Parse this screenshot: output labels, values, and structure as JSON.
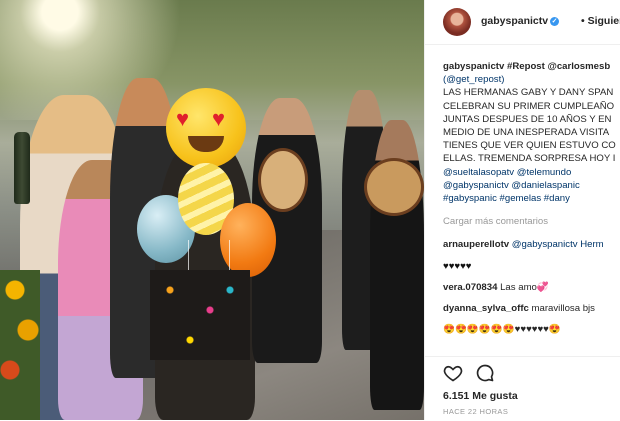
{
  "post": {
    "username": "gabyspanictv",
    "follow_label": "• Siguiendo"
  },
  "caption": {
    "lines": [
      "gabyspanictv #Repost @carlosmesb",
      "(@get_repost)",
      "LAS HERMANAS GABY Y DANY SPAN",
      "CELEBRAN SU PRIMER CUMPLEAÑO",
      "JUNTAS DESPUES DE 10 AÑOS Y EN",
      "MEDIO DE UNA INESPERADA VISITA",
      "TIENES QUE VER QUIEN ESTUVO CO",
      "ELLAS. TREMENDA SORPRESA HOY I",
      "@sueltalasopatv @telemundo",
      "@gabyspanictv @danielaspanic",
      "#gabyspanic #gemelas #dany"
    ]
  },
  "load_more": "Cargar más comentarios",
  "comments": [
    {
      "user": "arnauperellotv",
      "text": "@gabyspanictv Herm"
    },
    {
      "user": "",
      "text": "♥♥♥♥♥"
    },
    {
      "user": "vera.070834",
      "text": "Las amo💞"
    },
    {
      "user": "dyanna_sylva_offc",
      "text": "maravillosa bjs"
    },
    {
      "user": "",
      "text": "😍😍😍😍😍😍♥♥♥♥♥♥😍"
    }
  ],
  "likes": "6.151 Me gusta",
  "date": "HACE 22 HORAS",
  "colors": {
    "link": "#003569",
    "verified": "#3897f0",
    "muted": "#999999"
  }
}
